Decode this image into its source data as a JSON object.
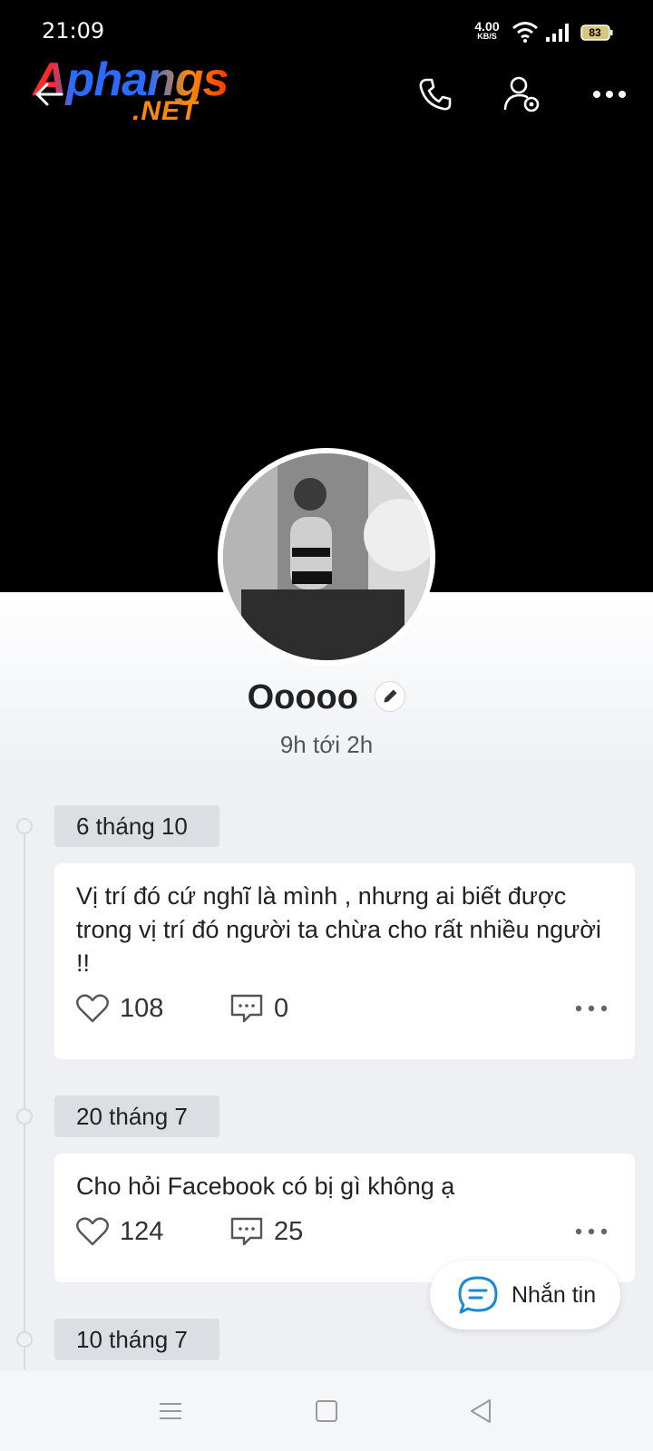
{
  "status_bar": {
    "time": "21:09",
    "net_speed_value": "4.00",
    "net_speed_unit": "KB/S",
    "battery": "83"
  },
  "watermark": {
    "main": "Aphangs",
    "suffix": ".NET"
  },
  "header": {
    "icons": [
      "back-arrow-icon",
      "phone-icon",
      "profile-settings-icon",
      "more-icon"
    ]
  },
  "profile": {
    "name": "Ooooo",
    "status": "9h tới 2h"
  },
  "posts": [
    {
      "date": "6 tháng 10",
      "text": "Vị trí đó cứ nghĩ là mình , nhưng ai biết được trong vị trí đó người ta chừa cho rất nhiều người !!",
      "likes": "108",
      "comments": "0"
    },
    {
      "date": "20 tháng 7",
      "text": "Cho hỏi Facebook có bị gì không ạ",
      "likes": "124",
      "comments": "25"
    },
    {
      "date": "10 tháng 7"
    }
  ],
  "fab": {
    "label": "Nhắn tin"
  },
  "colors": {
    "accent": "#1a8ad4",
    "background": "#eef0f4",
    "cover": "#000000"
  }
}
